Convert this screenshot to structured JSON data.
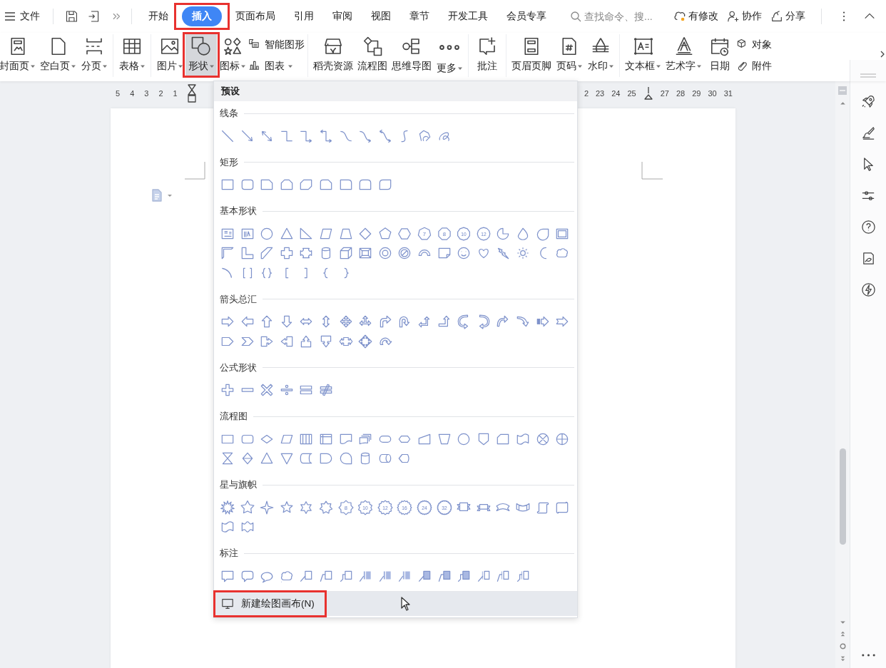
{
  "menu": {
    "label": "文件"
  },
  "tabs": [
    {
      "label": "开始",
      "selected": false,
      "highlighted": false
    },
    {
      "label": "插入",
      "selected": true,
      "highlighted": true
    },
    {
      "label": "页面布局",
      "selected": false,
      "highlighted": false
    },
    {
      "label": "引用",
      "selected": false,
      "highlighted": false
    },
    {
      "label": "审阅",
      "selected": false,
      "highlighted": false
    },
    {
      "label": "视图",
      "selected": false,
      "highlighted": false
    },
    {
      "label": "章节",
      "selected": false,
      "highlighted": false
    },
    {
      "label": "开发工具",
      "selected": false,
      "highlighted": false
    },
    {
      "label": "会员专享",
      "selected": false,
      "highlighted": false
    }
  ],
  "search": {
    "placeholder": "查找命令、搜..."
  },
  "actions": [
    {
      "label": "有修改"
    },
    {
      "label": "协作"
    },
    {
      "label": "分享"
    }
  ],
  "ribbon_groups": [
    [
      {
        "kind": "large",
        "label": "封面页",
        "dropdown": true,
        "selected": false,
        "highlighted": false
      },
      {
        "kind": "large",
        "label": "空白页",
        "dropdown": true,
        "selected": false,
        "highlighted": false
      },
      {
        "kind": "large",
        "label": "分页",
        "dropdown": true,
        "selected": false,
        "highlighted": false
      }
    ],
    [
      {
        "kind": "large",
        "label": "表格",
        "dropdown": true,
        "selected": false,
        "highlighted": false
      }
    ],
    [
      {
        "kind": "large",
        "label": "图片",
        "dropdown": true,
        "selected": false,
        "highlighted": false
      },
      {
        "kind": "large",
        "label": "形状",
        "dropdown": true,
        "selected": true,
        "highlighted": true
      },
      {
        "kind": "large",
        "label": "图标",
        "dropdown": true,
        "selected": false,
        "highlighted": false
      },
      {
        "kind": "small",
        "label": "智能图形",
        "dropdown": false,
        "selected": false,
        "highlighted": false
      },
      {
        "kind": "small",
        "label": "图表",
        "dropdown": true,
        "selected": false,
        "highlighted": false
      }
    ],
    [
      {
        "kind": "large",
        "label": "稻壳资源",
        "dropdown": false,
        "selected": false,
        "highlighted": false
      },
      {
        "kind": "large",
        "label": "流程图",
        "dropdown": false,
        "selected": false,
        "highlighted": false
      },
      {
        "kind": "large",
        "label": "思维导图",
        "dropdown": false,
        "selected": false,
        "highlighted": false
      },
      {
        "kind": "large",
        "label": "更多",
        "dropdown": true,
        "selected": false,
        "highlighted": false
      }
    ],
    [
      {
        "kind": "large",
        "label": "批注",
        "dropdown": false,
        "selected": false,
        "highlighted": false
      }
    ],
    [
      {
        "kind": "large",
        "label": "页眉页脚",
        "dropdown": false,
        "selected": false,
        "highlighted": false
      },
      {
        "kind": "large",
        "label": "页码",
        "dropdown": true,
        "selected": false,
        "highlighted": false
      },
      {
        "kind": "large",
        "label": "水印",
        "dropdown": true,
        "selected": false,
        "highlighted": false
      }
    ],
    [
      {
        "kind": "large",
        "label": "文本框",
        "dropdown": true,
        "selected": false,
        "highlighted": false
      },
      {
        "kind": "large",
        "label": "艺术字",
        "dropdown": true,
        "selected": false,
        "highlighted": false
      },
      {
        "kind": "large",
        "label": "日期",
        "dropdown": false,
        "selected": false,
        "highlighted": false
      },
      {
        "kind": "small",
        "label": "对象",
        "dropdown": false,
        "selected": false,
        "highlighted": false
      },
      {
        "kind": "small",
        "label": "附件",
        "dropdown": false,
        "selected": false,
        "highlighted": false
      }
    ]
  ],
  "ruler": {
    "left_numbers": [
      "5",
      "4",
      "3",
      "2",
      "1"
    ],
    "right_numbers": [
      "2",
      "23",
      "24",
      "25"
    ],
    "far_numbers": [
      "27",
      "28",
      "29",
      "30",
      "31"
    ]
  },
  "shapes_menu": {
    "header": "预设",
    "sections": [
      {
        "title": "线条"
      },
      {
        "title": "矩形"
      },
      {
        "title": "基本形状",
        "shape_numbers": [
          "7",
          "8",
          "10",
          "12"
        ]
      },
      {
        "title": "箭头总汇"
      },
      {
        "title": "公式形状"
      },
      {
        "title": "流程图"
      },
      {
        "title": "星与旗帜",
        "shape_numbers": [
          "8",
          "10",
          "12",
          "16",
          "24",
          "32"
        ]
      },
      {
        "title": "标注"
      }
    ],
    "canvas_button": {
      "label": "新建绘图画布(N)",
      "highlighted": true,
      "hovered": true
    }
  }
}
